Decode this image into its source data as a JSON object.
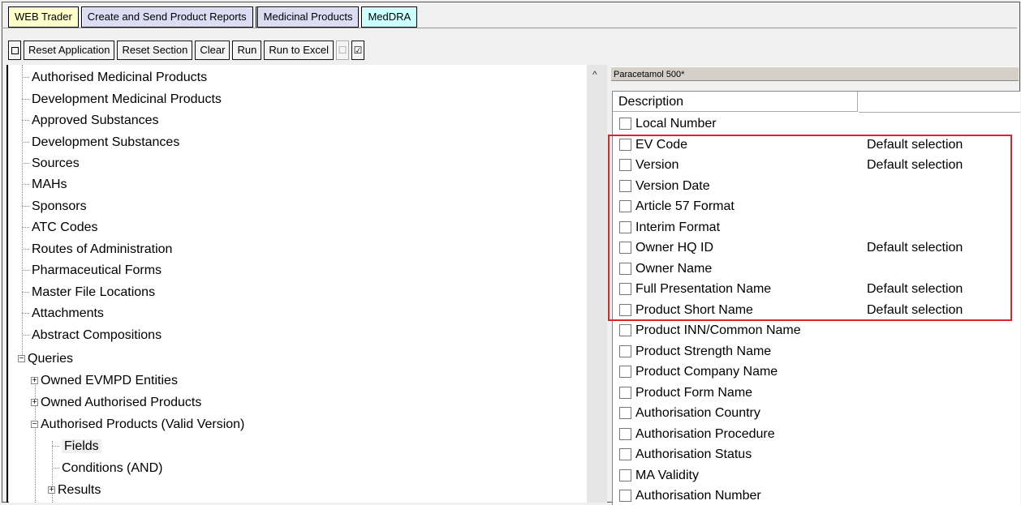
{
  "tabs": [
    {
      "label": "WEB Trader",
      "bg": "#ffffcc"
    },
    {
      "label": "Create and Send Product Reports",
      "bg": "#dcdcf4"
    },
    {
      "label": "Medicinal Products",
      "bg": "#dcdcf4"
    },
    {
      "label": "MedDRA",
      "bg": "#ccffff"
    }
  ],
  "toolbar": {
    "reset_application": "Reset Application",
    "reset_section": "Reset Section",
    "clear": "Clear",
    "run": "Run",
    "run_to_excel": "Run to Excel"
  },
  "tree": {
    "items": [
      "Authorised Medicinal Products",
      "Development Medicinal Products",
      "Approved Substances",
      "Development Substances",
      "Sources",
      "MAHs",
      "Sponsors",
      "ATC Codes",
      "Routes of Administration",
      "Pharmaceutical Forms",
      "Master File Locations",
      "Attachments",
      "Abstract Compositions"
    ],
    "queries": "Queries",
    "queries_children": [
      "Owned EVMPD Entities",
      "Owned Authorised Products",
      "Authorised Products (Valid Version)"
    ],
    "valid_version_children": [
      "Fields",
      "Conditions (AND)",
      "Results"
    ]
  },
  "right": {
    "header": "Paracetamol 500*",
    "col_description": "Description",
    "col_second": "",
    "rows": [
      {
        "name": "Local Number",
        "note": ""
      },
      {
        "name": "EV Code",
        "note": "Default selection"
      },
      {
        "name": "Version",
        "note": "Default selection"
      },
      {
        "name": "Version Date",
        "note": ""
      },
      {
        "name": "Article 57 Format",
        "note": ""
      },
      {
        "name": "Interim Format",
        "note": ""
      },
      {
        "name": "Owner HQ ID",
        "note": "Default selection"
      },
      {
        "name": "Owner Name",
        "note": ""
      },
      {
        "name": "Full Presentation Name",
        "note": "Default selection"
      },
      {
        "name": "Product Short Name",
        "note": "Default selection"
      },
      {
        "name": "Product INN/Common Name",
        "note": ""
      },
      {
        "name": "Product Strength Name",
        "note": ""
      },
      {
        "name": "Product Company Name",
        "note": ""
      },
      {
        "name": "Product Form Name",
        "note": ""
      },
      {
        "name": "Authorisation Country",
        "note": ""
      },
      {
        "name": "Authorisation Procedure",
        "note": ""
      },
      {
        "name": "Authorisation Status",
        "note": ""
      },
      {
        "name": "MA Validity",
        "note": ""
      },
      {
        "name": "Authorisation Number",
        "note": ""
      }
    ]
  },
  "colors": {
    "highlight": "#e0212e"
  }
}
